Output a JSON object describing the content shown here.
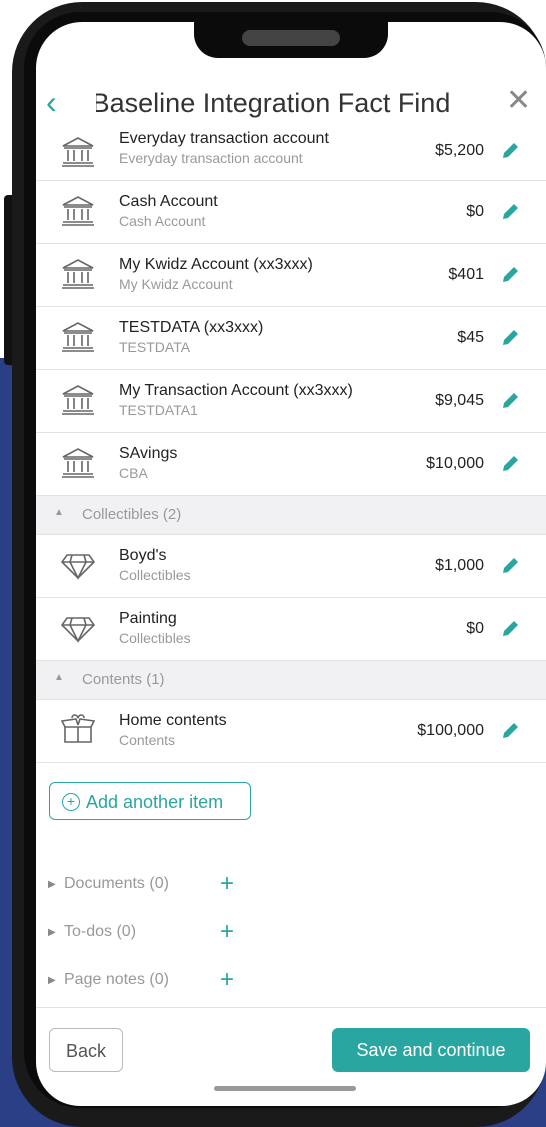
{
  "header": {
    "title": "Baseline Integration Fact Find"
  },
  "items": [
    {
      "name": "Everyday transaction account",
      "sub": "Everyday transaction account",
      "amount": "$5,200",
      "icon": "bank-icon"
    },
    {
      "name": "Cash Account",
      "sub": "Cash Account",
      "amount": "$0",
      "icon": "bank-icon"
    },
    {
      "name": "My Kwidz Account (xx3xxx)",
      "sub": "My Kwidz Account",
      "amount": "$401",
      "icon": "bank-icon"
    },
    {
      "name": "TESTDATA (xx3xxx)",
      "sub": "TESTDATA",
      "amount": "$45",
      "icon": "bank-icon"
    },
    {
      "name": "My Transaction Account (xx3xxx)",
      "sub": "TESTDATA1",
      "amount": "$9,045",
      "icon": "bank-icon"
    },
    {
      "name": "SAvings",
      "sub": "CBA",
      "amount": "$10,000",
      "icon": "bank-icon"
    }
  ],
  "sections": {
    "collectibles": {
      "label": "Collectibles (2)",
      "items": [
        {
          "name": "Boyd's",
          "sub": "Collectibles",
          "amount": "$1,000",
          "icon": "diamond-icon"
        },
        {
          "name": "Painting",
          "sub": "Collectibles",
          "amount": "$0",
          "icon": "diamond-icon"
        }
      ]
    },
    "contents": {
      "label": "Contents (1)",
      "items": [
        {
          "name": "Home contents",
          "sub": "Contents",
          "amount": "$100,000",
          "icon": "box-icon"
        }
      ]
    }
  },
  "add_item_label": "Add another item",
  "folds": [
    {
      "label": "Documents (0)"
    },
    {
      "label": "To-dos (0)"
    },
    {
      "label": "Page notes (0)"
    }
  ],
  "footer": {
    "back_label": "Back",
    "save_label": "Save and continue"
  },
  "colors": {
    "accent": "#2aa6a0",
    "background_blue": "#2a3f86"
  }
}
